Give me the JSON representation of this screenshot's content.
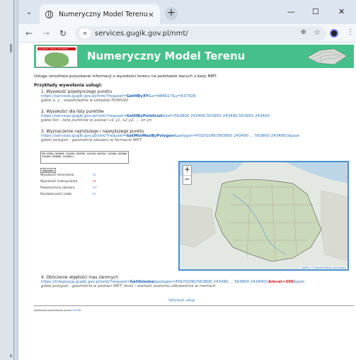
{
  "browser": {
    "tab_title": "Numeryczny Model Terenu",
    "tab_close": "×",
    "new_tab": "+",
    "url": "services.gugik.gov.pl/nmt/",
    "win_minimize": "—",
    "win_maximize": "☐",
    "win_close": "✕"
  },
  "header": {
    "title": "Numeryczny Model Terenu",
    "logo_text": "GŁÓWNY URZĄD GEODEZJI I KARTOGRAFII"
  },
  "intro": "Usługa umożliwia pozyskanie informacji o wysokości terenu na podstawie danych z bazy NMT.",
  "examples_title": "Przykłady wywołania usługi:",
  "examples": [
    {
      "head": "1. Wysokość pojedynczego punktu",
      "link_prefix": "https://services.gugik.gov.pl/nmt/?request=",
      "link_func": "GetHByXY",
      "link_suffix": "&x=486617&y=637928",
      "note": "gdzie x, y - współrzędne w układzie PUWG92"
    },
    {
      "head": "2. Wysokości dla listy punktów",
      "link_prefix": "https://services.gugik.gov.pl/nmt/?request=",
      "link_func": "GetHByPointList",
      "link_suffix": "&list=563800 243490,563950 243490,563950 243400",
      "note": "gdzie list - lista punktów w postaci x1 y1, x2 y2, ... xn yn"
    },
    {
      "head": "3. Wyznaczenie najniższego i najwyższego punktu",
      "link_prefix": "https://services.gugik.gov.pl/nmt/?request=",
      "link_func": "GetMinMaxByPolygon",
      "link_suffix": "&polygon=POLYGON((563800 243490 ... 563800 243490))&json",
      "note": "gdzie polygon - geometria obszaru w formacie WKT"
    }
  ],
  "tool": {
    "textarea_value": "POLYGON((563800 243490,563950 243490,563950 243400,563800 243400,563800 243490))",
    "button": "Wyznacz",
    "rows": [
      {
        "label": "Wysokość minimalna",
        "unit": "m"
      },
      {
        "label": "Wysokość maksymalna",
        "unit": "m"
      },
      {
        "label": "Powierzchnia obszaru",
        "unit": "m²"
      },
      {
        "label": "Rozdzielczość siatki",
        "unit": "m"
      }
    ]
  },
  "map": {
    "zoom_in": "+",
    "zoom_out": "−",
    "attribution_leaflet": "Leaflet",
    "attribution_osm": "© OpenStreetMap contributors"
  },
  "example4": {
    "head": "4. Obliczenie objętości mas ziemnych",
    "link_prefix": "https://integracja.gugik.gov.pl/nmt/?request=",
    "link_func": "GetVolume",
    "link_mid": "&polygon=POLYGON((563800 243490 ... 563800 243490))",
    "link_level": "&level=300",
    "link_end": "&json",
    "note": "gdzie polygon - geometria w postaci WKT, level - wartość poziomu odniesienia w metrach"
  },
  "stats_link": "Statystyki usługi",
  "footer_text": "Aplikacja opracowana przez",
  "footer_link": "GUGIK"
}
